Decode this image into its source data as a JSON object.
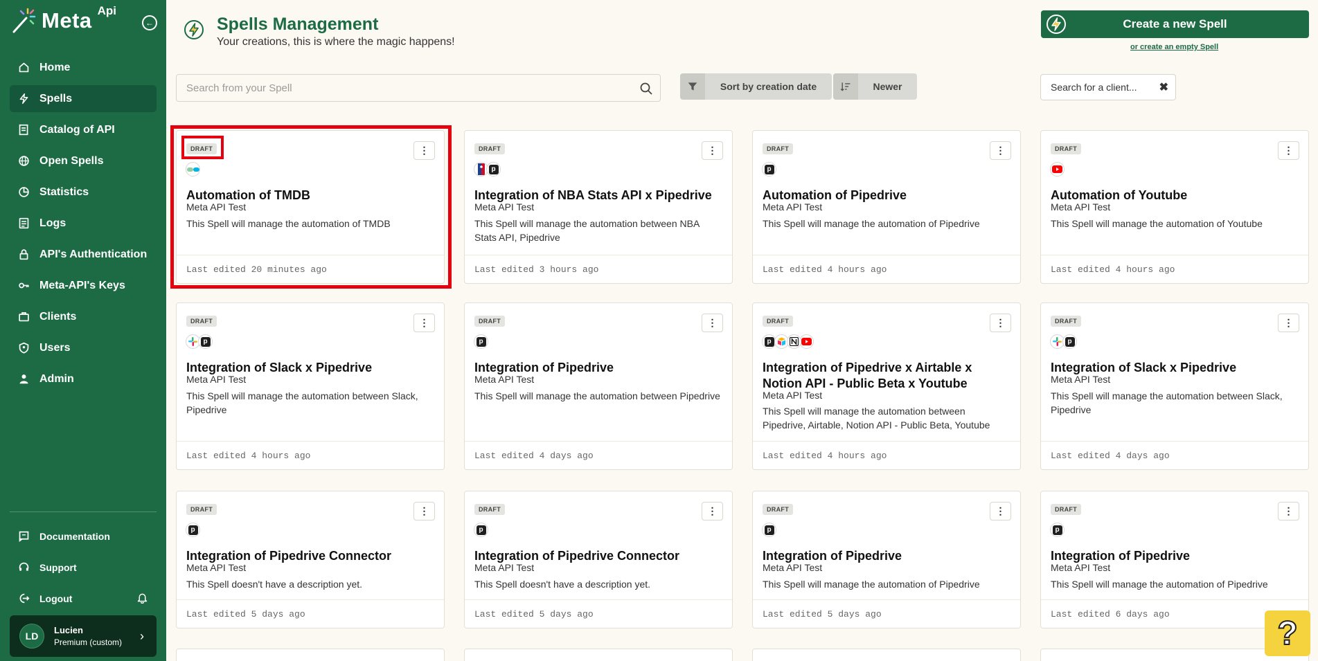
{
  "app": {
    "logo_text": "Meta",
    "logo_sup": "Api"
  },
  "sidebar": {
    "items": [
      {
        "label": "Home",
        "icon": "home-icon",
        "active": false
      },
      {
        "label": "Spells",
        "icon": "bolt-icon",
        "active": true
      },
      {
        "label": "Catalog of API",
        "icon": "catalog-icon",
        "active": false
      },
      {
        "label": "Open Spells",
        "icon": "globe-icon",
        "active": false
      },
      {
        "label": "Statistics",
        "icon": "pie-chart-icon",
        "active": false
      },
      {
        "label": "Logs",
        "icon": "logs-icon",
        "active": false
      },
      {
        "label": "API's Authentication",
        "icon": "lock-icon",
        "active": false
      },
      {
        "label": "Meta-API's Keys",
        "icon": "key-icon",
        "active": false
      },
      {
        "label": "Clients",
        "icon": "briefcase-icon",
        "active": false
      },
      {
        "label": "Users",
        "icon": "shield-user-icon",
        "active": false
      },
      {
        "label": "Admin",
        "icon": "person-icon",
        "active": false
      }
    ],
    "bottom": [
      {
        "label": "Documentation",
        "icon": "doc-icon"
      },
      {
        "label": "Support",
        "icon": "headset-icon"
      },
      {
        "label": "Logout",
        "icon": "logout-icon"
      }
    ],
    "user": {
      "initials": "LD",
      "name": "Lucien",
      "plan": "Premium (custom)"
    }
  },
  "header": {
    "title": "Spells Management",
    "subtitle": "Your creations, this is where the magic happens!",
    "create_button": "Create a new Spell",
    "empty_link": "or create an empty Spell"
  },
  "toolbar": {
    "search_placeholder": "Search from your Spell",
    "sort_label": "Sort by creation date",
    "order_label": "Newer",
    "client_placeholder": "Search for a client..."
  },
  "cards": [
    {
      "badge": "DRAFT",
      "logos": [
        "tmdb"
      ],
      "title": "Automation of TMDB",
      "owner": "Meta API Test",
      "description": "This Spell will manage the automation of TMDB",
      "edited": "Last edited 20 minutes ago"
    },
    {
      "badge": "DRAFT",
      "logos": [
        "nba",
        "pipedrive"
      ],
      "title": "Integration of NBA Stats API x Pipedrive",
      "owner": "Meta API Test",
      "description": "This Spell will manage the automation between NBA Stats API, Pipedrive",
      "edited": "Last edited 3 hours ago"
    },
    {
      "badge": "DRAFT",
      "logos": [
        "pipedrive"
      ],
      "title": "Automation of Pipedrive",
      "owner": "Meta API Test",
      "description": "This Spell will manage the automation of Pipedrive",
      "edited": "Last edited 4 hours ago"
    },
    {
      "badge": "DRAFT",
      "logos": [
        "youtube"
      ],
      "title": "Automation of Youtube",
      "owner": "Meta API Test",
      "description": "This Spell will manage the automation of Youtube",
      "edited": "Last edited 4 hours ago"
    },
    {
      "badge": "DRAFT",
      "logos": [
        "slack",
        "pipedrive"
      ],
      "title": "Integration of Slack x Pipedrive",
      "owner": "Meta API Test",
      "description": "This Spell will manage the automation between Slack, Pipedrive",
      "edited": "Last edited 4 hours ago"
    },
    {
      "badge": "DRAFT",
      "logos": [
        "pipedrive"
      ],
      "title": "Integration of Pipedrive",
      "owner": "Meta API Test",
      "description": "This Spell will manage the automation between Pipedrive",
      "edited": "Last edited 4 days ago"
    },
    {
      "badge": "DRAFT",
      "logos": [
        "pipedrive",
        "airtable",
        "notion",
        "youtube"
      ],
      "title": "Integration of Pipedrive x Airtable x Notion API - Public Beta x Youtube",
      "owner": "Meta API Test",
      "description": "This Spell will manage the automation between Pipedrive, Airtable, Notion API - Public Beta, Youtube",
      "edited": "Last edited 4 hours ago"
    },
    {
      "badge": "DRAFT",
      "logos": [
        "slack",
        "pipedrive"
      ],
      "title": "Integration of Slack x Pipedrive",
      "owner": "Meta API Test",
      "description": "This Spell will manage the automation between Slack, Pipedrive",
      "edited": "Last edited 4 days ago"
    },
    {
      "badge": "DRAFT",
      "logos": [
        "pipedrive"
      ],
      "title": "Integration of Pipedrive Connector",
      "owner": "Meta API Test",
      "description": "This Spell doesn't have a description yet.",
      "edited": "Last edited 5 days ago"
    },
    {
      "badge": "DRAFT",
      "logos": [
        "pipedrive"
      ],
      "title": "Integration of Pipedrive Connector",
      "owner": "Meta API Test",
      "description": "This Spell doesn't have a description yet.",
      "edited": "Last edited 5 days ago"
    },
    {
      "badge": "DRAFT",
      "logos": [
        "pipedrive"
      ],
      "title": "Integration of Pipedrive",
      "owner": "Meta API Test",
      "description": "This Spell will manage the automation of Pipedrive",
      "edited": "Last edited 5 days ago"
    },
    {
      "badge": "DRAFT",
      "logos": [
        "pipedrive"
      ],
      "title": "Integration of Pipedrive",
      "owner": "Meta API Test",
      "description": "This Spell will manage the automation of Pipedrive",
      "edited": "Last edited 6 days ago"
    }
  ],
  "help_label": "?",
  "colors": {
    "brand_green": "#1c6b45",
    "highlight_red": "#e3000f",
    "help_yellow": "#f4d33f"
  }
}
